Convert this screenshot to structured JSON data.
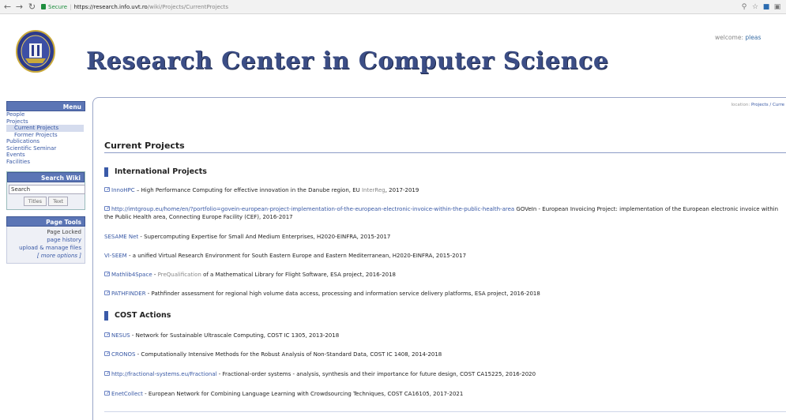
{
  "browser": {
    "back_icon": "back-arrow-icon",
    "forward_icon": "forward-arrow-icon",
    "reload_icon": "reload-icon",
    "secure_label": "Secure",
    "url_host": "https://research.info.uvt.ro",
    "url_path": "/wiki/Projects/CurrentProjects",
    "zoom_icon": "zoom-icon",
    "star_icon": "star-icon",
    "extension_icons": [
      "extension-icon",
      "extension-icon"
    ]
  },
  "header": {
    "title": "Research Center in Computer Science",
    "welcome_prefix": "welcome: ",
    "welcome_link": "pleas",
    "logo_icon": "university-seal-logo"
  },
  "sidebar": {
    "menu_title": "Menu",
    "items": [
      {
        "label": "People"
      },
      {
        "label": "Projects"
      },
      {
        "label": "Current Projects"
      },
      {
        "label": "Former Projects"
      },
      {
        "label": "Publications"
      },
      {
        "label": "Scientific Seminar"
      },
      {
        "label": "Events"
      },
      {
        "label": "Facilities"
      }
    ],
    "search_title": "Search Wiki",
    "search_value": "Search",
    "titles_button": "Titles",
    "text_button": "Text",
    "tools_title": "Page Tools",
    "tools": {
      "locked": "Page Locked",
      "history": "page history",
      "upload": "upload & manage files",
      "more": "[ more options ]"
    }
  },
  "content": {
    "location_prefix": "location: ",
    "location_link": "Projects / Curre",
    "page_title": "Current Projects",
    "section_international": "International Projects",
    "section_cost": "COST Actions",
    "international": [
      {
        "link": "InnoHPC",
        "text": " – High Performance Computing for effective innovation in the Danube region, EU ",
        "grey": "InterReg",
        "tail": ", 2017-2019"
      },
      {
        "link": "http://imtgroup.eu/home/en/?portfolio=govein-european-project-implementation-of-the-european-electronic-invoice-within-the-public-health-area",
        "text": " GOVeIn - European Invoicing Project: implementation of the European electronic invoice within the Public Health area, Connecting Europe Facility (CEF), 2016-2017"
      },
      {
        "link": "SESAME Net",
        "text": " - Supercomputing Expertise for Small And Medium Enterprises, H2020-EINFRA, 2015-2017"
      },
      {
        "link": "VI-SEEM",
        "text": " - a unified Virtual Research Environment for South Eastern Europe and Eastern Mediterranean, H2020-EINFRA, 2015-2017"
      },
      {
        "link": "Mathlib4Space",
        "text": " - ",
        "grey": "PreQualification",
        "tail": " of a Mathematical Library for Flight Software, ESA project, 2016-2018"
      },
      {
        "link": "PATHFINDER",
        "text": " - Pathfinder assessment for regional high volume data access, processing and information service delivery platforms, ESA project, 2016-2018"
      }
    ],
    "cost": [
      {
        "link": "NESUS",
        "text": " - Network for Sustainable Ultrascale Computing, COST IC 1305, 2013-2018"
      },
      {
        "link": "CRONOS",
        "text": " - Computationally Intensive Methods for the Robust Analysis of Non-Standard Data, COST IC 1408, 2014-2018"
      },
      {
        "link": "http://fractional-systems.eu/Fractional",
        "text": " - Fractional-order systems - analysis, synthesis and their importance for future design, COST CA15225, 2016-2020"
      },
      {
        "link": "EnetCollect",
        "text": " - European Network for Combining Language Learning with Crowdsourcing Techniques, COST CA16105, 2017-2021"
      }
    ]
  },
  "colors": {
    "title": "#3c4e86",
    "link": "#3858a5",
    "accent": "#5b75b5"
  }
}
